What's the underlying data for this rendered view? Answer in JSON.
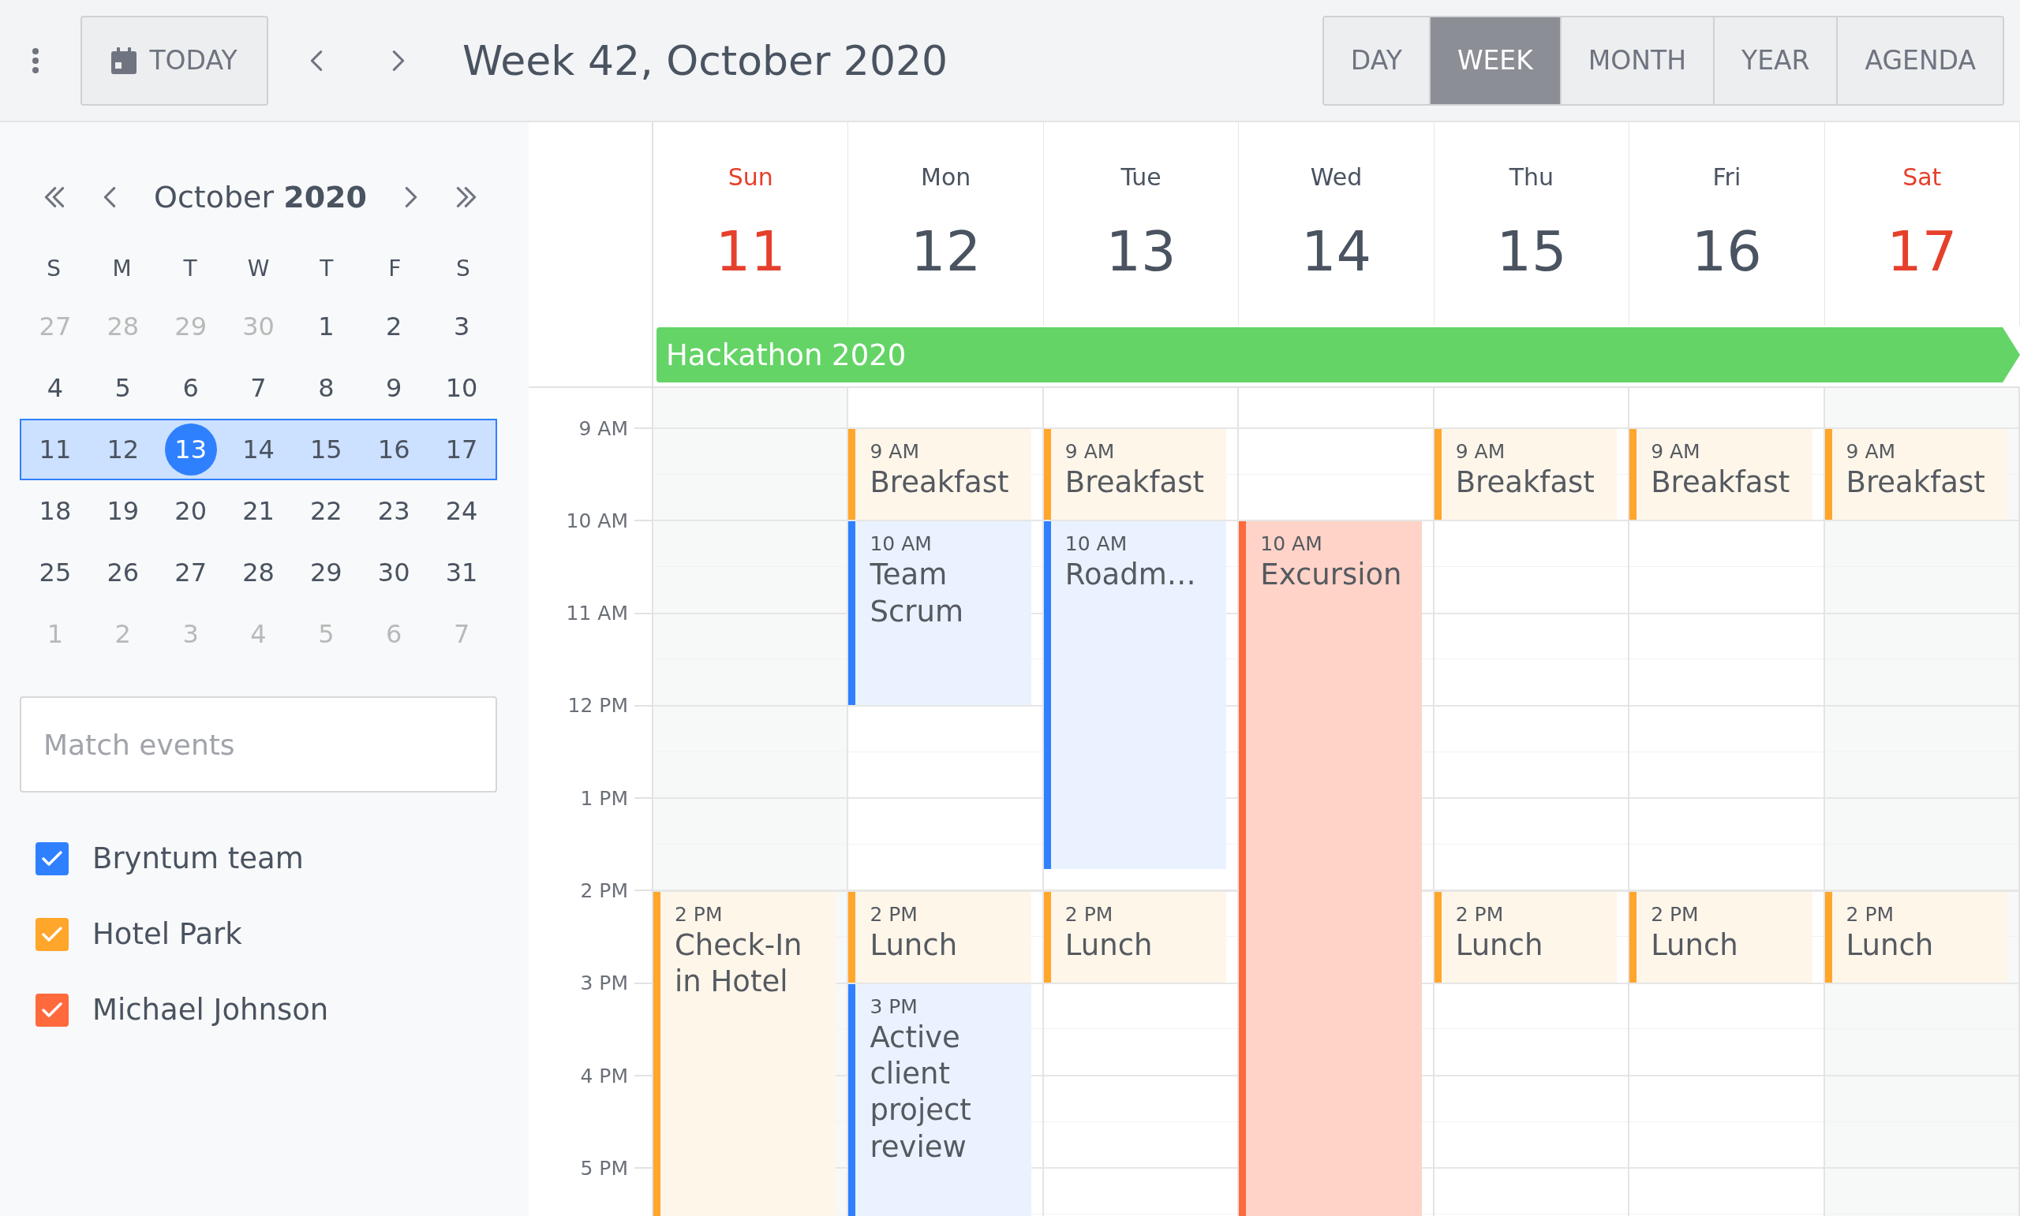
{
  "toolbar": {
    "today": "TODAY",
    "title": "Week 42, October 2020",
    "views": [
      {
        "label": "DAY",
        "selected": false
      },
      {
        "label": "WEEK",
        "selected": true
      },
      {
        "label": "MONTH",
        "selected": false
      },
      {
        "label": "YEAR",
        "selected": false
      },
      {
        "label": "AGENDA",
        "selected": false
      }
    ]
  },
  "mini_calendar": {
    "title": "October **2020**",
    "weekdays": [
      "S",
      "M",
      "T",
      "W",
      "T",
      "F",
      "S"
    ],
    "weeks": [
      {
        "selected": false,
        "days": [
          {
            "label": "27",
            "other_month": true,
            "selected": false
          },
          {
            "label": "28",
            "other_month": true,
            "selected": false
          },
          {
            "label": "29",
            "other_month": true,
            "selected": false
          },
          {
            "label": "30",
            "other_month": true,
            "selected": false
          },
          {
            "label": "1",
            "other_month": false,
            "selected": false
          },
          {
            "label": "2",
            "other_month": false,
            "selected": false
          },
          {
            "label": "3",
            "other_month": false,
            "selected": false
          }
        ]
      },
      {
        "selected": false,
        "days": [
          {
            "label": "4",
            "other_month": false,
            "selected": false
          },
          {
            "label": "5",
            "other_month": false,
            "selected": false
          },
          {
            "label": "6",
            "other_month": false,
            "selected": false
          },
          {
            "label": "7",
            "other_month": false,
            "selected": false
          },
          {
            "label": "8",
            "other_month": false,
            "selected": false
          },
          {
            "label": "9",
            "other_month": false,
            "selected": false
          },
          {
            "label": "10",
            "other_month": false,
            "selected": false
          }
        ]
      },
      {
        "selected": true,
        "days": [
          {
            "label": "11",
            "other_month": false,
            "selected": false
          },
          {
            "label": "12",
            "other_month": false,
            "selected": false
          },
          {
            "label": "13",
            "other_month": false,
            "selected": true
          },
          {
            "label": "14",
            "other_month": false,
            "selected": false
          },
          {
            "label": "15",
            "other_month": false,
            "selected": false
          },
          {
            "label": "16",
            "other_month": false,
            "selected": false
          },
          {
            "label": "17",
            "other_month": false,
            "selected": false
          }
        ]
      },
      {
        "selected": false,
        "days": [
          {
            "label": "18",
            "other_month": false,
            "selected": false
          },
          {
            "label": "19",
            "other_month": false,
            "selected": false
          },
          {
            "label": "20",
            "other_month": false,
            "selected": false
          },
          {
            "label": "21",
            "other_month": false,
            "selected": false
          },
          {
            "label": "22",
            "other_month": false,
            "selected": false
          },
          {
            "label": "23",
            "other_month": false,
            "selected": false
          },
          {
            "label": "24",
            "other_month": false,
            "selected": false
          }
        ]
      },
      {
        "selected": false,
        "days": [
          {
            "label": "25",
            "other_month": false,
            "selected": false
          },
          {
            "label": "26",
            "other_month": false,
            "selected": false
          },
          {
            "label": "27",
            "other_month": false,
            "selected": false
          },
          {
            "label": "28",
            "other_month": false,
            "selected": false
          },
          {
            "label": "29",
            "other_month": false,
            "selected": false
          },
          {
            "label": "30",
            "other_month": false,
            "selected": false
          },
          {
            "label": "31",
            "other_month": false,
            "selected": false
          }
        ]
      },
      {
        "selected": false,
        "days": [
          {
            "label": "1",
            "other_month": true,
            "selected": false
          },
          {
            "label": "2",
            "other_month": true,
            "selected": false
          },
          {
            "label": "3",
            "other_month": true,
            "selected": false
          },
          {
            "label": "4",
            "other_month": true,
            "selected": false
          },
          {
            "label": "5",
            "other_month": true,
            "selected": false
          },
          {
            "label": "6",
            "other_month": true,
            "selected": false
          },
          {
            "label": "7",
            "other_month": true,
            "selected": false
          }
        ]
      }
    ]
  },
  "search": {
    "placeholder": "Match events"
  },
  "calendars": [
    {
      "label": "Bryntum team",
      "checked": true,
      "color": "#2f80ff"
    },
    {
      "label": "Hotel Park",
      "checked": true,
      "color": "#ffa62b"
    },
    {
      "label": "Michael Johnson",
      "checked": true,
      "color": "#ff6a3d"
    }
  ],
  "all_day_events": [
    {
      "title": "Hackathon 2020",
      "color": "#64d466"
    }
  ],
  "time_labels": [
    "9 AM",
    "10 AM",
    "11 AM",
    "12 PM",
    "1 PM",
    "2 PM",
    "3 PM",
    "4 PM",
    "5 PM"
  ],
  "days": [
    {
      "name": "Sun",
      "date": "11",
      "weekend": true,
      "events": [
        {
          "time": "2 PM",
          "title": "Check-In in Hotel",
          "color": "#ffa62b"
        }
      ]
    },
    {
      "name": "Mon",
      "date": "12",
      "weekend": false,
      "events": [
        {
          "time": "9 AM",
          "title": "Breakfast",
          "color": "#ffa62b"
        },
        {
          "time": "10 AM",
          "title": "Team Scrum",
          "color": "#2f80ff"
        },
        {
          "time": "2 PM",
          "title": "Lunch",
          "color": "#ffa62b"
        },
        {
          "time": "3 PM",
          "title": "Active client project review",
          "color": "#2f80ff"
        }
      ]
    },
    {
      "name": "Tue",
      "date": "13",
      "weekend": false,
      "events": [
        {
          "time": "9 AM",
          "title": "Breakfast",
          "color": "#ffa62b"
        },
        {
          "time": "10 AM",
          "title": "Roadm…",
          "color": "#2f80ff"
        },
        {
          "time": "2 PM",
          "title": "Lunch",
          "color": "#ffa62b"
        }
      ]
    },
    {
      "name": "Wed",
      "date": "14",
      "weekend": false,
      "events": [
        {
          "time": "10 AM",
          "title": "Excursion",
          "color": "#ff6a3d"
        }
      ]
    },
    {
      "name": "Thu",
      "date": "15",
      "weekend": false,
      "events": [
        {
          "time": "9 AM",
          "title": "Breakfast",
          "color": "#ffa62b"
        },
        {
          "time": "2 PM",
          "title": "Lunch",
          "color": "#ffa62b"
        }
      ]
    },
    {
      "name": "Fri",
      "date": "16",
      "weekend": false,
      "events": [
        {
          "time": "9 AM",
          "title": "Breakfast",
          "color": "#ffa62b"
        },
        {
          "time": "2 PM",
          "title": "Lunch",
          "color": "#ffa62b"
        }
      ]
    },
    {
      "name": "Sat",
      "date": "17",
      "weekend": true,
      "events": [
        {
          "time": "9 AM",
          "title": "Breakfast",
          "color": "#ffa62b"
        },
        {
          "time": "2 PM",
          "title": "Lunch",
          "color": "#ffa62b"
        }
      ]
    }
  ]
}
